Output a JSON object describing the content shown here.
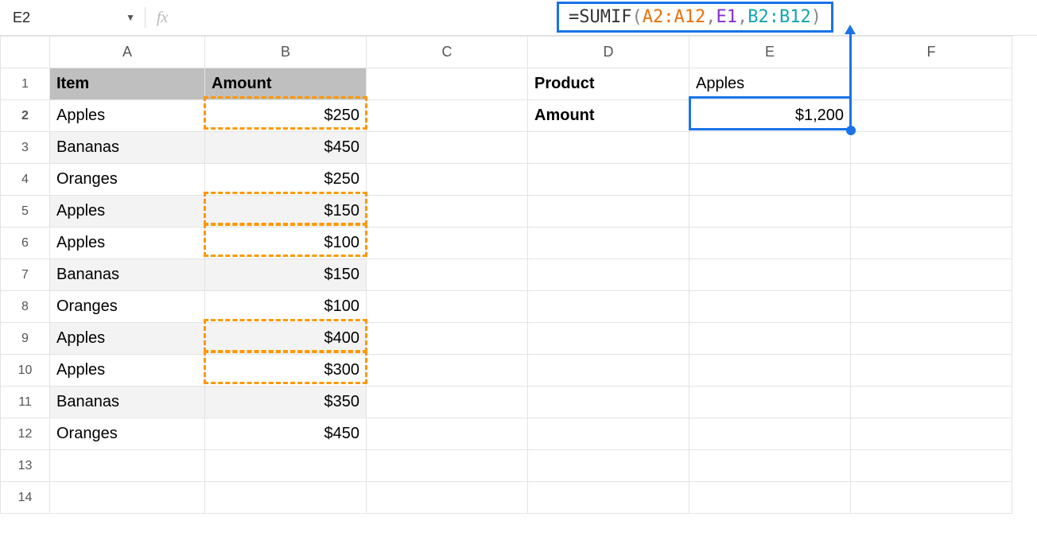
{
  "namebox": {
    "cell": "E2"
  },
  "fx_label": "fx",
  "formula": {
    "eq": "=",
    "fn": "SUMIF",
    "open": "(",
    "arg1": "A2:A12",
    "c1": ",",
    "arg2": "E1",
    "c2": ",",
    "arg3": "B2:B12",
    "close": ")"
  },
  "cols": {
    "A": "A",
    "B": "B",
    "C": "C",
    "D": "D",
    "E": "E",
    "F": "F"
  },
  "rows": {
    "1": "1",
    "2": "2",
    "3": "3",
    "4": "4",
    "5": "5",
    "6": "6",
    "7": "7",
    "8": "8",
    "9": "9",
    "10": "10",
    "11": "11",
    "12": "12",
    "13": "13",
    "14": "14"
  },
  "headers": {
    "item": "Item",
    "amount": "Amount"
  },
  "data": [
    {
      "item": "Apples",
      "amount": "$250"
    },
    {
      "item": "Bananas",
      "amount": "$450"
    },
    {
      "item": "Oranges",
      "amount": "$250"
    },
    {
      "item": "Apples",
      "amount": "$150"
    },
    {
      "item": "Apples",
      "amount": "$100"
    },
    {
      "item": "Bananas",
      "amount": "$150"
    },
    {
      "item": "Oranges",
      "amount": "$100"
    },
    {
      "item": "Apples",
      "amount": "$400"
    },
    {
      "item": "Apples",
      "amount": "$300"
    },
    {
      "item": "Bananas",
      "amount": "$350"
    },
    {
      "item": "Oranges",
      "amount": "$450"
    }
  ],
  "lookup": {
    "product_label": "Product",
    "product_value": "Apples",
    "amount_label": "Amount",
    "amount_value": "$1,200"
  }
}
